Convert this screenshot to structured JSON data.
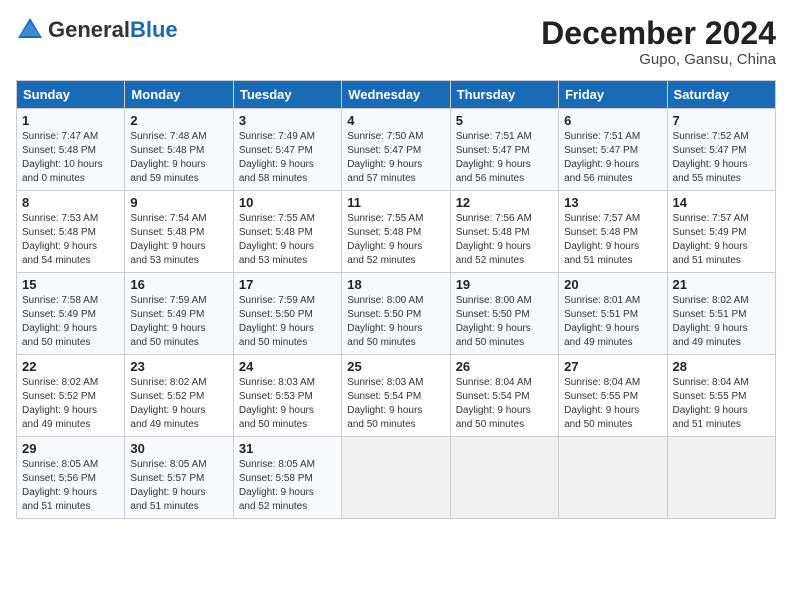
{
  "header": {
    "logo_general": "General",
    "logo_blue": "Blue",
    "month_year": "December 2024",
    "location": "Gupo, Gansu, China"
  },
  "days_of_week": [
    "Sunday",
    "Monday",
    "Tuesday",
    "Wednesday",
    "Thursday",
    "Friday",
    "Saturday"
  ],
  "weeks": [
    [
      {
        "day": "1",
        "sunrise": "7:47 AM",
        "sunset": "5:48 PM",
        "daylight": "10 hours and 0 minutes."
      },
      {
        "day": "2",
        "sunrise": "7:48 AM",
        "sunset": "5:48 PM",
        "daylight": "9 hours and 59 minutes."
      },
      {
        "day": "3",
        "sunrise": "7:49 AM",
        "sunset": "5:47 PM",
        "daylight": "9 hours and 58 minutes."
      },
      {
        "day": "4",
        "sunrise": "7:50 AM",
        "sunset": "5:47 PM",
        "daylight": "9 hours and 57 minutes."
      },
      {
        "day": "5",
        "sunrise": "7:51 AM",
        "sunset": "5:47 PM",
        "daylight": "9 hours and 56 minutes."
      },
      {
        "day": "6",
        "sunrise": "7:51 AM",
        "sunset": "5:47 PM",
        "daylight": "9 hours and 56 minutes."
      },
      {
        "day": "7",
        "sunrise": "7:52 AM",
        "sunset": "5:47 PM",
        "daylight": "9 hours and 55 minutes."
      }
    ],
    [
      {
        "day": "8",
        "sunrise": "7:53 AM",
        "sunset": "5:48 PM",
        "daylight": "9 hours and 54 minutes."
      },
      {
        "day": "9",
        "sunrise": "7:54 AM",
        "sunset": "5:48 PM",
        "daylight": "9 hours and 53 minutes."
      },
      {
        "day": "10",
        "sunrise": "7:55 AM",
        "sunset": "5:48 PM",
        "daylight": "9 hours and 53 minutes."
      },
      {
        "day": "11",
        "sunrise": "7:55 AM",
        "sunset": "5:48 PM",
        "daylight": "9 hours and 52 minutes."
      },
      {
        "day": "12",
        "sunrise": "7:56 AM",
        "sunset": "5:48 PM",
        "daylight": "9 hours and 52 minutes."
      },
      {
        "day": "13",
        "sunrise": "7:57 AM",
        "sunset": "5:48 PM",
        "daylight": "9 hours and 51 minutes."
      },
      {
        "day": "14",
        "sunrise": "7:57 AM",
        "sunset": "5:49 PM",
        "daylight": "9 hours and 51 minutes."
      }
    ],
    [
      {
        "day": "15",
        "sunrise": "7:58 AM",
        "sunset": "5:49 PM",
        "daylight": "9 hours and 50 minutes."
      },
      {
        "day": "16",
        "sunrise": "7:59 AM",
        "sunset": "5:49 PM",
        "daylight": "9 hours and 50 minutes."
      },
      {
        "day": "17",
        "sunrise": "7:59 AM",
        "sunset": "5:50 PM",
        "daylight": "9 hours and 50 minutes."
      },
      {
        "day": "18",
        "sunrise": "8:00 AM",
        "sunset": "5:50 PM",
        "daylight": "9 hours and 50 minutes."
      },
      {
        "day": "19",
        "sunrise": "8:00 AM",
        "sunset": "5:50 PM",
        "daylight": "9 hours and 50 minutes."
      },
      {
        "day": "20",
        "sunrise": "8:01 AM",
        "sunset": "5:51 PM",
        "daylight": "9 hours and 49 minutes."
      },
      {
        "day": "21",
        "sunrise": "8:02 AM",
        "sunset": "5:51 PM",
        "daylight": "9 hours and 49 minutes."
      }
    ],
    [
      {
        "day": "22",
        "sunrise": "8:02 AM",
        "sunset": "5:52 PM",
        "daylight": "9 hours and 49 minutes."
      },
      {
        "day": "23",
        "sunrise": "8:02 AM",
        "sunset": "5:52 PM",
        "daylight": "9 hours and 49 minutes."
      },
      {
        "day": "24",
        "sunrise": "8:03 AM",
        "sunset": "5:53 PM",
        "daylight": "9 hours and 50 minutes."
      },
      {
        "day": "25",
        "sunrise": "8:03 AM",
        "sunset": "5:54 PM",
        "daylight": "9 hours and 50 minutes."
      },
      {
        "day": "26",
        "sunrise": "8:04 AM",
        "sunset": "5:54 PM",
        "daylight": "9 hours and 50 minutes."
      },
      {
        "day": "27",
        "sunrise": "8:04 AM",
        "sunset": "5:55 PM",
        "daylight": "9 hours and 50 minutes."
      },
      {
        "day": "28",
        "sunrise": "8:04 AM",
        "sunset": "5:55 PM",
        "daylight": "9 hours and 51 minutes."
      }
    ],
    [
      {
        "day": "29",
        "sunrise": "8:05 AM",
        "sunset": "5:56 PM",
        "daylight": "9 hours and 51 minutes."
      },
      {
        "day": "30",
        "sunrise": "8:05 AM",
        "sunset": "5:57 PM",
        "daylight": "9 hours and 51 minutes."
      },
      {
        "day": "31",
        "sunrise": "8:05 AM",
        "sunset": "5:58 PM",
        "daylight": "9 hours and 52 minutes."
      },
      null,
      null,
      null,
      null
    ]
  ]
}
